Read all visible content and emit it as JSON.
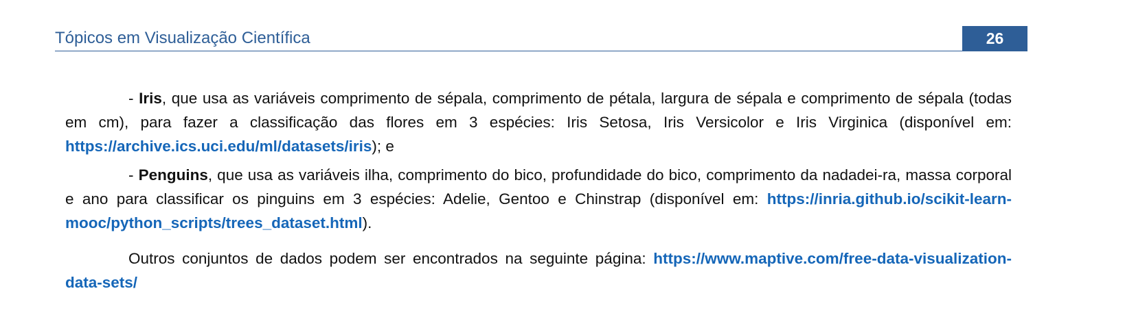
{
  "header": {
    "title": "Tópicos em Visualização Científica",
    "page_number": "26"
  },
  "paragraphs": {
    "iris": {
      "dash": "- ",
      "name": "Iris",
      "text": ", que usa as variáveis comprimento de sépala, comprimento de pétala, largura de sépala e comprimento de sépala (todas em cm), para fazer a classificação das flores em 3 espécies: Iris Setosa, Iris Versicolor e Iris Virginica (disponível em: ",
      "link": "https://archive.ics.uci.edu/ml/datasets/iris",
      "tail": "); e"
    },
    "penguins": {
      "dash": "- ",
      "name": "Penguins",
      "text": ", que usa as variáveis ilha, comprimento do bico, profundidade do bico, comprimento da nadadei-ra, massa corporal e ano para classificar os pinguins em 3 espécies: Adelie, Gentoo e Chinstrap (disponível em: ",
      "link": "https://inria.github.io/scikit-learn-mooc/python_scripts/trees_dataset.html",
      "tail": ")."
    },
    "outros": {
      "text": "Outros conjuntos de dados podem ser encontrados na seguinte página: ",
      "link": "https://www.maptive.com/free-data-visualization-data-sets/"
    }
  },
  "colors": {
    "header_blue": "#2e5e97",
    "link_blue": "#1566b8"
  }
}
